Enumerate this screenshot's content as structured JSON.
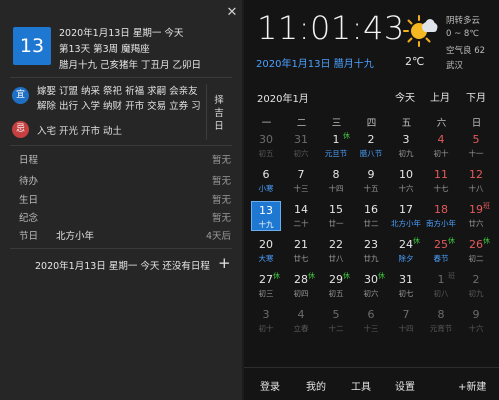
{
  "left": {
    "close_icon": "✕",
    "day_number": "13",
    "date_line": "2020年1月13日 星期一 今天",
    "week_line": "第13天 第3周 魔羯座",
    "lunar_line": "腊月十九 己亥猪年 丁丑月 乙卯日",
    "yi_label": "宜",
    "yi_text": "嫁娶 订盟 纳采 祭祀 祈福 求嗣 会亲友 解除 出行 入学 纳财 开市 交易 立券 习艺…",
    "ji_label": "忌",
    "ji_text": "入宅 开光 开市 动土",
    "zeji": "择吉日",
    "events": [
      {
        "key": "日程",
        "mid": "",
        "val": "暂无"
      },
      {
        "key": "待办",
        "mid": "",
        "val": "暂无"
      },
      {
        "key": "生日",
        "mid": "",
        "val": "暂无"
      },
      {
        "key": "纪念",
        "mid": "",
        "val": "暂无"
      },
      {
        "key": "节日",
        "mid": "北方小年",
        "val": "4天后"
      }
    ],
    "footer_text": "2020年1月13日 星期一 今天 还没有日程",
    "add_icon": "+"
  },
  "right": {
    "clock": "11:01:43",
    "full_date": "2020年1月13日 腊月十九",
    "weather_icon": "partly-cloudy-sun-icon",
    "temperature": "2℃",
    "weather_desc": "阴转多云",
    "temp_range": "0 ~ 8℃",
    "aqi": "空气良 62",
    "city": "武汉",
    "month_label": "2020年1月",
    "nav_today": "今天",
    "nav_prev": "上月",
    "nav_next": "下月",
    "weekdays": [
      "一",
      "二",
      "三",
      "四",
      "五",
      "六",
      "日"
    ],
    "days": [
      {
        "n": "30",
        "s": "初五",
        "other": true
      },
      {
        "n": "31",
        "s": "初六",
        "other": true
      },
      {
        "n": "1",
        "s": "元旦节",
        "badge": "休",
        "sub": "blue"
      },
      {
        "n": "2",
        "s": "腊八节",
        "sub": "blue"
      },
      {
        "n": "3",
        "s": "初九"
      },
      {
        "n": "4",
        "s": "初十",
        "red": true
      },
      {
        "n": "5",
        "s": "十一",
        "red": true
      },
      {
        "n": "6",
        "s": "小寒",
        "sub": "blue"
      },
      {
        "n": "7",
        "s": "十三"
      },
      {
        "n": "8",
        "s": "十四"
      },
      {
        "n": "9",
        "s": "十五"
      },
      {
        "n": "10",
        "s": "十六"
      },
      {
        "n": "11",
        "s": "十七",
        "red": true
      },
      {
        "n": "12",
        "s": "十八",
        "red": true
      },
      {
        "n": "13",
        "s": "十九",
        "selected": true
      },
      {
        "n": "14",
        "s": "二十"
      },
      {
        "n": "15",
        "s": "廿一"
      },
      {
        "n": "16",
        "s": "廿二"
      },
      {
        "n": "17",
        "s": "北方小年",
        "sub": "blue"
      },
      {
        "n": "18",
        "s": "南方小年",
        "red": true,
        "sub": "blue"
      },
      {
        "n": "19",
        "s": "廿六",
        "red": true,
        "badge": "班",
        "badge_type": "ban"
      },
      {
        "n": "20",
        "s": "大寒",
        "sub": "blue"
      },
      {
        "n": "21",
        "s": "廿七"
      },
      {
        "n": "22",
        "s": "廿八"
      },
      {
        "n": "23",
        "s": "廿九"
      },
      {
        "n": "24",
        "s": "除夕",
        "badge": "休",
        "sub": "blue"
      },
      {
        "n": "25",
        "s": "春节",
        "red": true,
        "badge": "休",
        "sub": "blue"
      },
      {
        "n": "26",
        "s": "初二",
        "red": true,
        "badge": "休"
      },
      {
        "n": "27",
        "s": "初三",
        "badge": "休"
      },
      {
        "n": "28",
        "s": "初四",
        "badge": "休"
      },
      {
        "n": "29",
        "s": "初五",
        "badge": "休"
      },
      {
        "n": "30",
        "s": "初六",
        "badge": "休"
      },
      {
        "n": "31",
        "s": "初七"
      },
      {
        "n": "1",
        "s": "初八",
        "other": true,
        "badge": "班",
        "badge_type": "ban"
      },
      {
        "n": "2",
        "s": "初九",
        "other": true
      },
      {
        "n": "3",
        "s": "初十",
        "other": true
      },
      {
        "n": "4",
        "s": "立春",
        "other": true
      },
      {
        "n": "5",
        "s": "十二",
        "other": true
      },
      {
        "n": "6",
        "s": "十三",
        "other": true
      },
      {
        "n": "7",
        "s": "十四",
        "other": true
      },
      {
        "n": "8",
        "s": "元宵节",
        "other": true
      },
      {
        "n": "9",
        "s": "十六",
        "other": true
      }
    ],
    "bottom_bar": [
      "登录",
      "我的",
      "工具",
      "设置",
      "+新建"
    ]
  }
}
